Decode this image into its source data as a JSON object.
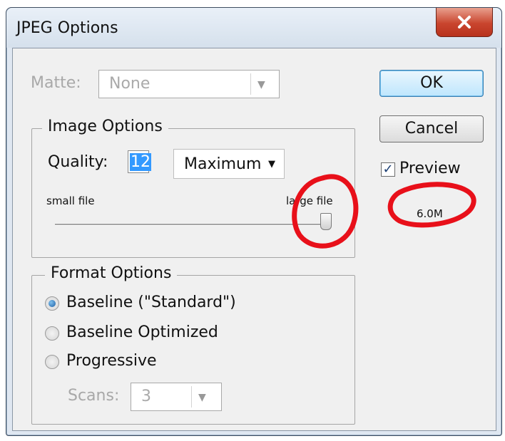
{
  "window": {
    "title": "JPEG Options"
  },
  "matte": {
    "label": "Matte:",
    "value": "None"
  },
  "image_options": {
    "legend": "Image Options",
    "quality_label": "Quality:",
    "quality_value": "12",
    "quality_preset": "Maximum",
    "small_file_label": "small file",
    "large_file_label": "large file",
    "slider_value": 12,
    "slider_max": 12
  },
  "format_options": {
    "legend": "Format Options",
    "options": [
      {
        "label": "Baseline (\"Standard\")",
        "selected": true
      },
      {
        "label": "Baseline Optimized",
        "selected": false
      },
      {
        "label": "Progressive",
        "selected": false
      }
    ],
    "scans_label": "Scans:",
    "scans_value": "3"
  },
  "buttons": {
    "ok": "OK",
    "cancel": "Cancel"
  },
  "preview": {
    "label": "Preview",
    "checked": true,
    "size": "6.0M"
  },
  "colors": {
    "annotation": "#e8101a",
    "accent": "#3c7fb1",
    "close": "#c9452e"
  }
}
